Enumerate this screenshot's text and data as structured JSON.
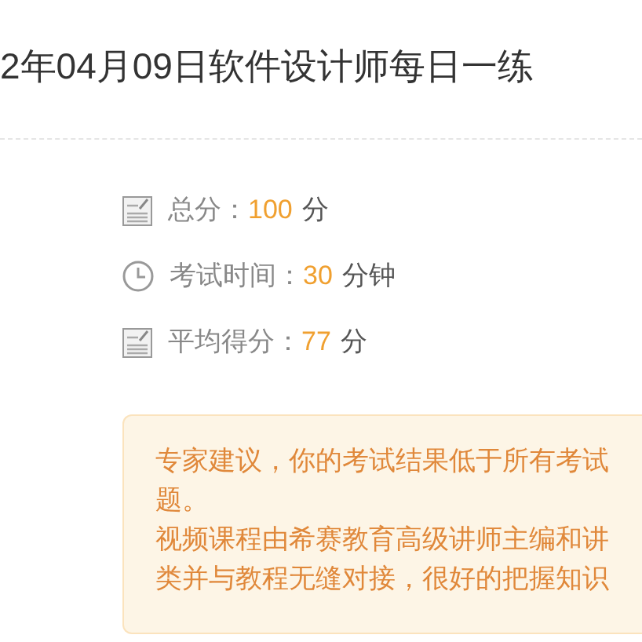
{
  "title": "2年04月09日软件设计师每日一练",
  "stats": [
    {
      "kind": "score",
      "label": "总分：",
      "value": "100",
      "unit": "分"
    },
    {
      "kind": "clock",
      "label": "考试时间：",
      "value": "30",
      "unit": "分钟"
    },
    {
      "kind": "score",
      "label": "平均得分：",
      "value": "77",
      "unit": "分"
    }
  ],
  "advice": [
    "专家建议，你的考试结果低于所有考试",
    "题。",
    "视频课程由希赛教育高级讲师主编和讲",
    "类并与教程无缝对接，很好的把握知识"
  ]
}
